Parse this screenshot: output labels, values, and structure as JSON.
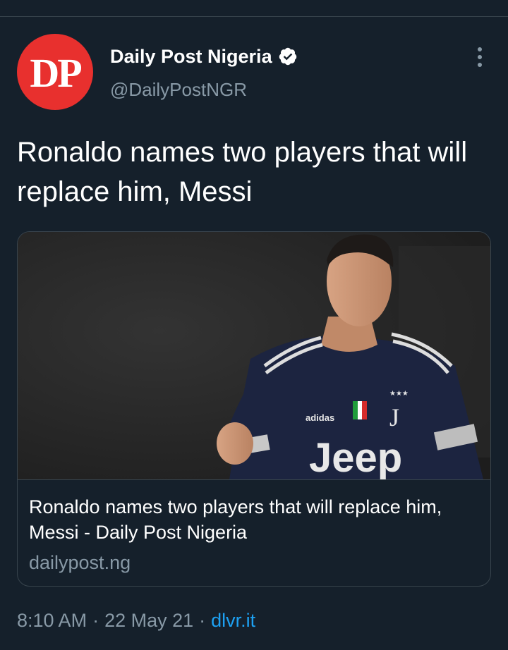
{
  "tweet": {
    "avatar_text": "DP",
    "display_name": "Daily Post Nigeria",
    "handle": "@DailyPostNGR",
    "verified": true,
    "text": "Ronaldo names two players that will replace him, Messi",
    "card": {
      "image_description_icon": "player-photo",
      "title": "Ronaldo names two players that will replace him, Messi - Daily Post Nigeria",
      "domain": "dailypost.ng",
      "jersey_text": "Jeep",
      "jersey_brand": "adidas"
    },
    "time": "8:10 AM",
    "date": "22 May 21",
    "separator": "·",
    "source": "dlvr.it"
  },
  "colors": {
    "background": "#15202b",
    "avatar_red": "#e8302e",
    "secondary_text": "#8899a6",
    "link_blue": "#1da1f2",
    "border": "#38444d"
  },
  "icons": {
    "verified": "verified-badge-icon",
    "more": "more-vertical-icon"
  }
}
